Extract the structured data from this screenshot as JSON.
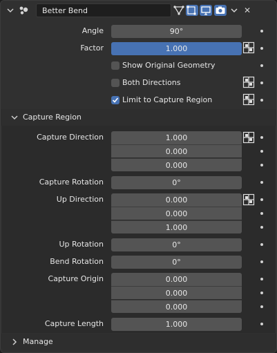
{
  "header": {
    "modifier_name": "Better Bend",
    "close_glyph": "✕",
    "icons": [
      "modifier-icon",
      "vertex-select-icon",
      "edit-mode-icon",
      "realtime-display-icon",
      "render-camera-icon",
      "chevron-down-icon"
    ]
  },
  "props": {
    "angle_label": "Angle",
    "angle_value": "90°",
    "factor_label": "Factor",
    "factor_value": "1.000",
    "factor_fraction": 1.0,
    "show_original_label": "Show Original Geometry",
    "show_original_checked": false,
    "both_directions_label": "Both Directions",
    "both_directions_checked": false,
    "limit_label": "Limit to Capture Region",
    "limit_checked": true
  },
  "capture_region": {
    "title": "Capture Region",
    "capture_direction_label": "Capture Direction",
    "capture_direction": [
      "1.000",
      "0.000",
      "0.000"
    ],
    "capture_rotation_label": "Capture Rotation",
    "capture_rotation": "0°",
    "up_direction_label": "Up Direction",
    "up_direction": [
      "0.000",
      "0.000",
      "1.000"
    ],
    "up_rotation_label": "Up Rotation",
    "up_rotation": "0°",
    "bend_rotation_label": "Bend Rotation",
    "bend_rotation": "0°",
    "capture_origin_label": "Capture Origin",
    "capture_origin": [
      "0.000",
      "0.000",
      "0.000"
    ],
    "capture_length_label": "Capture Length",
    "capture_length": "1.000"
  },
  "manage": {
    "title": "Manage"
  },
  "colors": {
    "accent": "#4772b3",
    "field": "#545454",
    "panel": "#303030"
  }
}
